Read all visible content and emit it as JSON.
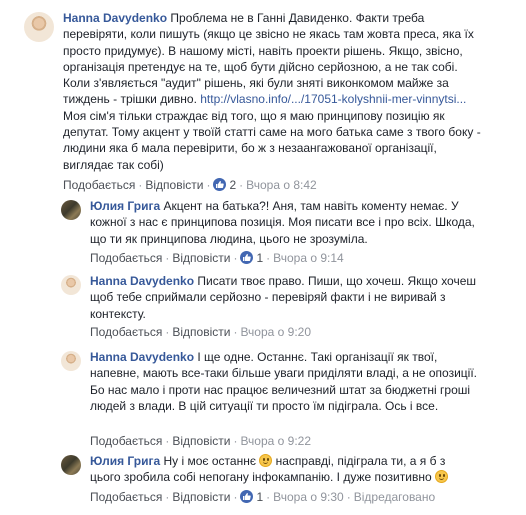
{
  "comments": [
    {
      "author": "Hanna Davydenko",
      "text_before_link": "Проблема не в Ганні Давиденко. Факти треба перевіряти, коли пишуть (якщо це звісно не якась там жовта преса, яка їх просто придумує). В нашому місті, навіть проекти рішень. Якщо, звісно, організація претендує на те, щоб бути дійсно серйозною, а не так собі. Коли з'являється \"аудит\" рішень, які були зняті виконкомом майже за тиждень - трішки дивно. ",
      "link": "http://vlasno.info/.../17051-kolyshnii-mer-vinnytsi...",
      "text_after_link": "Моя сім'я тільки страждає від того, що я маю принципову позицію як депутат. Тому акцент у твоїй статті саме на мого батька саме з твого боку - людини яка б мала перевірити, бо ж з незаангажованої організації, виглядає так собі)",
      "like_label": "Подобається",
      "reply_label": "Відповісти",
      "like_count": "2",
      "time": "Вчора о 8:42"
    },
    {
      "author": "Юлия Грига",
      "text": "Акцент на батька?! Аня, там навіть коменту немає. У кожної з нас є принципова позиція. Моя писати все і про всіх. Шкода, що ти як принципова людина, цього не зрозуміла.",
      "like_label": "Подобається",
      "reply_label": "Відповісти",
      "like_count": "1",
      "time": "Вчора о 9:14"
    },
    {
      "author": "Hanna Davydenko",
      "text": "Писати твоє право. Пиши, що хочеш. Якщо хочеш щоб тебе сприймали серйозно - перевіряй факти і не виривай з контексту.",
      "like_label": "Подобається",
      "reply_label": "Відповісти",
      "time": "Вчора о 9:20"
    },
    {
      "author": "Hanna Davydenko",
      "text": "І ще одне. Останнє. Такі організації як твої, напевне, мають все-таки більше уваги приділяти владі, а не опозиції. Бо нас мало і проти нас працює величезний штат за бюджетні гроші людей з влади. В цій ситуації ти просто їм підіграла. Ось і все.",
      "like_label": "Подобається",
      "reply_label": "Відповісти",
      "time": "Вчора о 9:22"
    },
    {
      "author": "Юлия Грига",
      "text_part1": "Ну і моє останнє ",
      "text_part2": " насправді, підіграла ти, а я б з цього зробила собі непогану інфокампанію. І дуже позитивно ",
      "like_label": "Подобається",
      "reply_label": "Відповісти",
      "like_count": "1",
      "time": "Вчора о 9:30",
      "edited_label": "Відредаговано"
    }
  ]
}
